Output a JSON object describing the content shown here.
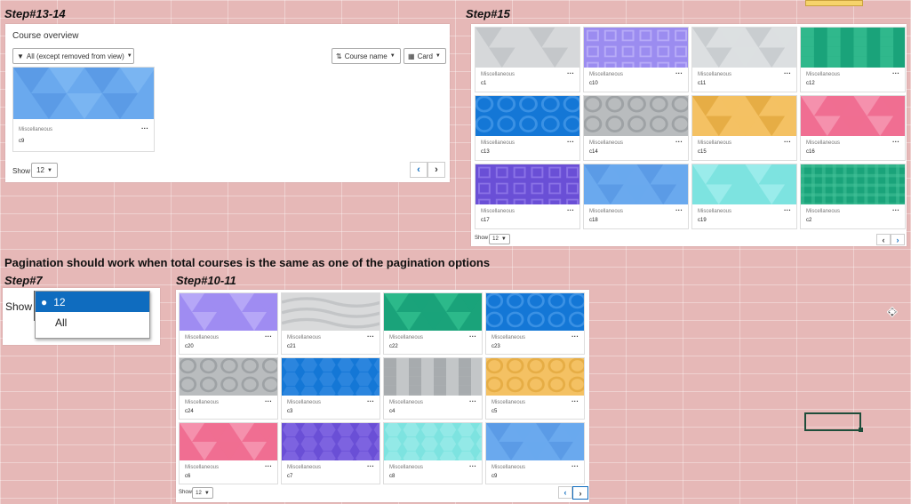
{
  "labels": {
    "step13": "Step#13-14",
    "step15": "Step#15",
    "step7": "Step#7",
    "step10": "Step#10-11",
    "headline": "Pagination should work when total courses is the same as one of the pagination options"
  },
  "panel1": {
    "title": "Course overview",
    "filter": "All (except removed from view)",
    "sort": "Course name",
    "view": "Card",
    "card": {
      "category": "Miscellaneous",
      "name": "c9"
    },
    "show_label": "Show",
    "show_value": "12"
  },
  "panel2": {
    "cards": [
      {
        "category": "Miscellaneous",
        "name": "c1"
      },
      {
        "category": "Miscellaneous",
        "name": "c10"
      },
      {
        "category": "Miscellaneous",
        "name": "c11"
      },
      {
        "category": "Miscellaneous",
        "name": "c12"
      },
      {
        "category": "Miscellaneous",
        "name": "c13"
      },
      {
        "category": "Miscellaneous",
        "name": "c14"
      },
      {
        "category": "Miscellaneous",
        "name": "c15"
      },
      {
        "category": "Miscellaneous",
        "name": "c16"
      },
      {
        "category": "Miscellaneous",
        "name": "c17"
      },
      {
        "category": "Miscellaneous",
        "name": "c18"
      },
      {
        "category": "Miscellaneous",
        "name": "c19"
      },
      {
        "category": "Miscellaneous",
        "name": "c2"
      }
    ],
    "show_label": "Show",
    "show_value": "12"
  },
  "dropdown": {
    "show_label": "Show",
    "options": [
      "12",
      "All"
    ]
  },
  "panel3": {
    "cards": [
      {
        "category": "Miscellaneous",
        "name": "c20"
      },
      {
        "category": "Miscellaneous",
        "name": "c21"
      },
      {
        "category": "Miscellaneous",
        "name": "c22"
      },
      {
        "category": "Miscellaneous",
        "name": "c23"
      },
      {
        "category": "Miscellaneous",
        "name": "c24"
      },
      {
        "category": "Miscellaneous",
        "name": "c3"
      },
      {
        "category": "Miscellaneous",
        "name": "c4"
      },
      {
        "category": "Miscellaneous",
        "name": "c5"
      },
      {
        "category": "Miscellaneous",
        "name": "c6"
      },
      {
        "category": "Miscellaneous",
        "name": "c7"
      },
      {
        "category": "Miscellaneous",
        "name": "c8"
      },
      {
        "category": "Miscellaneous",
        "name": "c9"
      }
    ],
    "show_label": "Show",
    "show_value": "12"
  },
  "icons": [
    "filter-icon",
    "sort-icon",
    "grid-icon",
    "more-icon",
    "chevron-left-icon",
    "chevron-right-icon",
    "move-cursor-icon",
    "pointer-cursor-icon"
  ],
  "colors": {
    "background": "#e6b8b7",
    "accent": "#0f6cbf",
    "selected_option": "#0f6cbf"
  }
}
